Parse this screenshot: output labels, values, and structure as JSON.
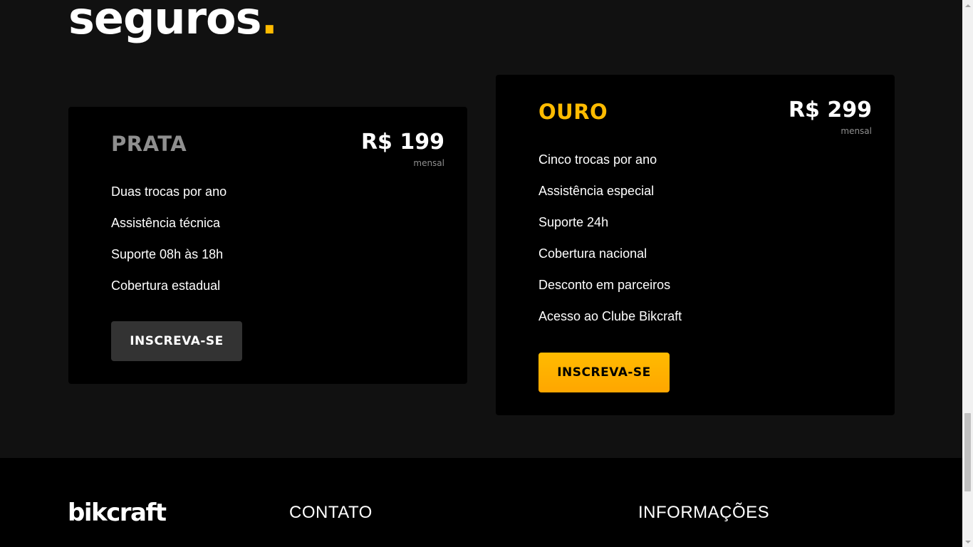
{
  "section": {
    "heading": "seguros",
    "heading_dot": "."
  },
  "plans": [
    {
      "name": "PRATA",
      "price": "R$ 199",
      "period": "mensal",
      "features": [
        "Duas trocas por ano",
        "Assistência técnica",
        "Suporte 08h às 18h",
        "Cobertura estadual"
      ],
      "cta": "INSCREVA-SE"
    },
    {
      "name": "OURO",
      "price": "R$ 299",
      "period": "mensal",
      "features": [
        "Cinco trocas por ano",
        "Assistência especial",
        "Suporte 24h",
        "Cobertura nacional",
        "Desconto em parceiros",
        "Acesso ao Clube Bikcraft"
      ],
      "cta": "INSCREVA-SE"
    }
  ],
  "footer": {
    "logo": "bikcraft",
    "contact_title": "CONTATO",
    "info_title": "INFORMAÇÕES"
  },
  "colors": {
    "accent": "#ffbb00",
    "background": "#111111",
    "card": "#000000",
    "muted": "#8f8f8f"
  }
}
